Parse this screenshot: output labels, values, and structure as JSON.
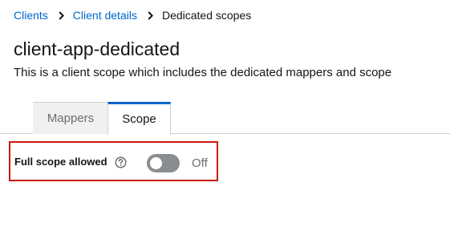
{
  "breadcrumb": {
    "items": [
      {
        "label": "Clients"
      },
      {
        "label": "Client details"
      },
      {
        "label": "Dedicated scopes"
      }
    ]
  },
  "page": {
    "title": "client-app-dedicated",
    "description": "This is a client scope which includes the dedicated mappers and scope"
  },
  "tabs": [
    {
      "label": "Mappers",
      "active": false
    },
    {
      "label": "Scope",
      "active": true
    }
  ],
  "form": {
    "full_scope": {
      "label": "Full scope allowed",
      "help_icon": "question-circle-icon",
      "enabled": false,
      "state_label": "Off"
    }
  },
  "colors": {
    "link": "#0066cc",
    "active_tab_border": "#0066cc",
    "highlight_border": "#c9190b",
    "switch_off": "#8a8d90"
  }
}
